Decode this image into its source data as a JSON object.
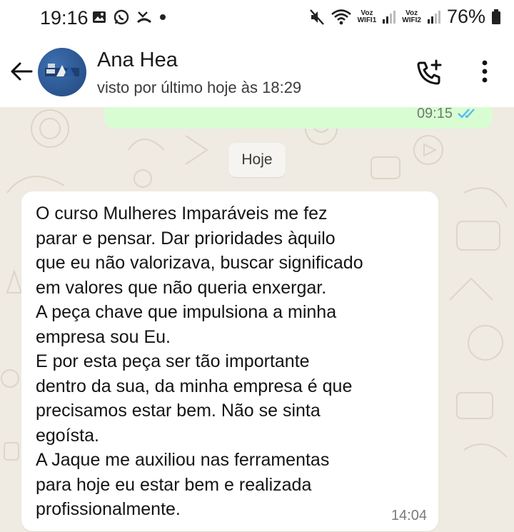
{
  "status_bar": {
    "time": "19:16",
    "icons_left": [
      "gallery-icon",
      "whatsapp-icon",
      "missed-call-icon",
      "dot-icon"
    ],
    "icons_right": [
      "mute-icon",
      "wifi-icon",
      "signal-icon",
      "signal-icon",
      "battery-icon"
    ],
    "sim1_label_top": "Voz",
    "sim1_label_bottom": "WIFI1",
    "sim2_label_top": "Voz",
    "sim2_label_bottom": "WIFI2",
    "battery": "76%"
  },
  "header": {
    "name": "Ana Hea",
    "status": "visto por último hoje às 18:29"
  },
  "chat": {
    "previous_message_time": "09:15",
    "date_separator": "Hoje",
    "message": {
      "text": "O curso Mulheres Imparáveis me fez\nparar e pensar. Dar prioridades àquilo\nque eu não valorizava, buscar significado\nem valores que não queria enxergar.\nA peça chave que impulsiona a minha\nempresa sou Eu.\nE por esta peça ser tão importante\ndentro da sua, da minha empresa é que\nprecisamos estar bem. Não se sinta\negoísta.\nA Jaque me auxiliou nas ferramentas\npara hoje eu estar bem e realizada\nprofissionalmente.",
      "time": "14:04"
    }
  },
  "colors": {
    "chat_background": "#efeae2",
    "outgoing_bubble": "#d9fdd3",
    "read_ticks": "#53bdeb"
  }
}
